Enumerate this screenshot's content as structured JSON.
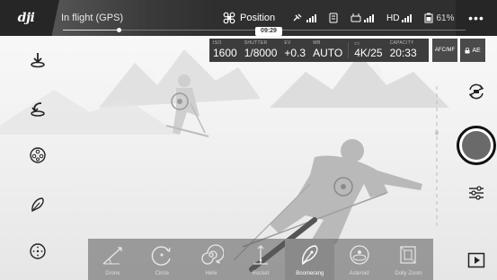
{
  "topbar": {
    "logo": "dji",
    "flight_status": "In flight (GPS)",
    "flight_mode": "Position",
    "hd_label": "HD",
    "battery_percent": "61%",
    "more": "•••",
    "timer": "09:29"
  },
  "camera": {
    "iso_label": "ISO",
    "iso": "1600",
    "shutter_label": "SHUTTER",
    "shutter": "1/8000",
    "ev_label": "EV",
    "ev": "+0.3",
    "wb_label": "WB",
    "wb": "AUTO",
    "resolution": "4K/25",
    "capacity_label": "CAPACITY",
    "capacity": "20:33",
    "af_button": "AFC/MF",
    "ae_button": "AE"
  },
  "quickshots": [
    {
      "label": "Drone",
      "icon": "dronie-icon",
      "active": false
    },
    {
      "label": "Circle",
      "icon": "circle-icon",
      "active": false
    },
    {
      "label": "Helix",
      "icon": "helix-icon",
      "active": false
    },
    {
      "label": "Rocket",
      "icon": "rocket-icon",
      "active": false
    },
    {
      "label": "Boomerang",
      "icon": "boomerang-icon",
      "active": true
    },
    {
      "label": "Asteroid",
      "icon": "asteroid-icon",
      "active": false
    },
    {
      "label": "Dolly Zoom",
      "icon": "dolly-zoom-icon",
      "active": false
    }
  ],
  "left_toolbar": [
    "takeoff-icon",
    "return-home-icon",
    "intelligent-modes-icon",
    "quickshot-icon",
    "navigation-icon"
  ],
  "right_toolbar": [
    "switch-camera-icon",
    "shutter-button",
    "camera-settings-icon",
    "playback-icon"
  ],
  "colors": {
    "topbar": "#2f2f2f",
    "shutter": "#6a6a6a",
    "active_tile": "#8a8a8a"
  }
}
